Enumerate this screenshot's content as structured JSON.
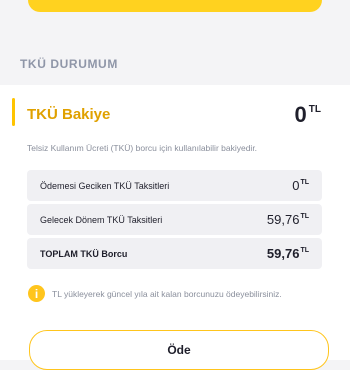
{
  "section": {
    "title": "TKÜ DURUMUM"
  },
  "balance": {
    "label": "TKÜ Bakiye",
    "value": "0",
    "currency": "TL"
  },
  "description": "Telsiz Kullanım Ücreti (TKÜ) borcu için kullanılabilir bakiyedir.",
  "rows": [
    {
      "label": "Ödemesi Geciken TKÜ Taksitleri",
      "value": "0",
      "currency": "TL"
    },
    {
      "label": "Gelecek Dönem TKÜ Taksitleri",
      "value": "59,76",
      "currency": "TL"
    },
    {
      "label": "TOPLAM TKÜ Borcu",
      "value": "59,76",
      "currency": "TL"
    }
  ],
  "info": {
    "icon": "info-icon",
    "text": "TL yükleyerek güncel yıla ait kalan borcunuzu ödeyebilirsiniz."
  },
  "pay_button": {
    "label": "Öde"
  },
  "colors": {
    "accent": "#ffc51d",
    "label_accent": "#e0a100"
  }
}
